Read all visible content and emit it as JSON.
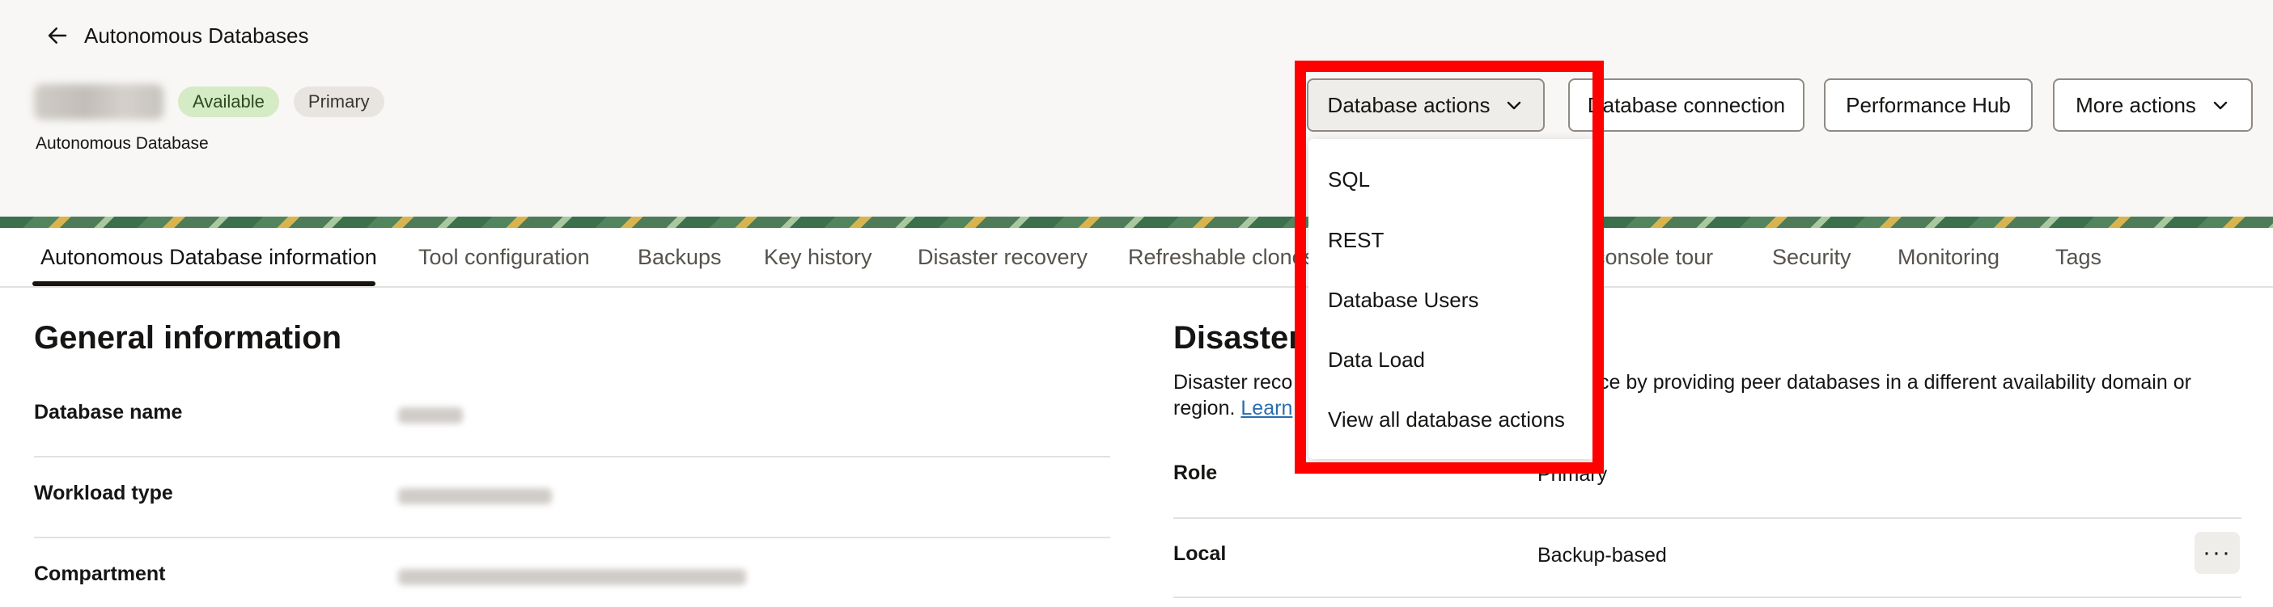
{
  "header": {
    "back_label": "Autonomous Databases",
    "badges": {
      "available": "Available",
      "primary": "Primary"
    },
    "subtitle": "Autonomous Database",
    "actions": {
      "database_actions": "Database actions",
      "database_connection": "Database connection",
      "performance_hub": "Performance Hub",
      "more_actions": "More actions"
    }
  },
  "tabs": [
    {
      "label": "Autonomous Database information",
      "selected": true
    },
    {
      "label": "Tool configuration"
    },
    {
      "label": "Backups"
    },
    {
      "label": "Key history"
    },
    {
      "label": "Disaster recovery"
    },
    {
      "label": "Refreshable clones"
    },
    {
      "label": "console tour"
    },
    {
      "label": "Security"
    },
    {
      "label": "Monitoring"
    },
    {
      "label": "Tags"
    }
  ],
  "general": {
    "title": "General information",
    "fields": [
      {
        "label": "Database name"
      },
      {
        "label": "Workload type"
      },
      {
        "label": "Compartment"
      }
    ]
  },
  "disaster": {
    "title_partial": "Disaster",
    "description_line1_start": "Disaster reco",
    "description_line1_end": "ce by providing peer databases in a different availability domain or",
    "description_line2_start": "region.",
    "learn_more_partial": "Learn",
    "role_label": "Role",
    "role_value_partial": "Primary",
    "local_label": "Local",
    "local_value": "Backup-based",
    "more_glyph": "···"
  },
  "dropdown": {
    "items": [
      "SQL",
      "REST",
      "Database Users",
      "Data Load",
      "View all database actions"
    ]
  },
  "colors": {
    "available_badge_bg": "#d4ebc6",
    "highlight": "#ff0000",
    "link": "#2a6cae"
  }
}
